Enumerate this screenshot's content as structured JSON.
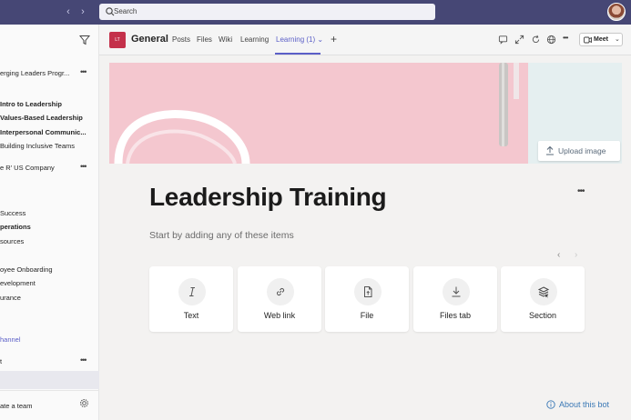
{
  "topbar": {
    "back_arrow": "‹",
    "forward_arrow": "›",
    "search_placeholder": "Search",
    "colors": {
      "background": "#464775"
    }
  },
  "sidebar": {
    "items": [
      {
        "label": "erging Leaders Progr...",
        "style": "normal"
      },
      {
        "label": "Intro to Leadership",
        "style": "bold"
      },
      {
        "label": "Values-Based Leadership",
        "style": "bold"
      },
      {
        "label": "Interpersonal Communic...",
        "style": "bold"
      },
      {
        "label": "Building Inclusive Teams",
        "style": "normal"
      },
      {
        "label": "e R' US Company",
        "style": "normal"
      },
      {
        "label": "Success",
        "style": "normal"
      },
      {
        "label": "perations",
        "style": "bold"
      },
      {
        "label": "sources",
        "style": "normal"
      },
      {
        "label": "oyee Onboarding",
        "style": "normal"
      },
      {
        "label": "evelopment",
        "style": "normal"
      },
      {
        "label": "urance",
        "style": "normal"
      },
      {
        "label": "hannel",
        "style": "link"
      },
      {
        "label": "t",
        "style": "normal"
      }
    ],
    "more_label": "•••",
    "footer_label": "ate a team"
  },
  "header": {
    "team_logo_text": "LT",
    "channel_title": "General",
    "tabs": [
      {
        "label": "Posts"
      },
      {
        "label": "Files"
      },
      {
        "label": "Wiki"
      },
      {
        "label": "Learning"
      },
      {
        "label": "Learning (1) ⌄",
        "active": true
      }
    ],
    "add_tab": "+",
    "more_label": "•••",
    "meet_label": "Meet",
    "meet_chevron": "⌄",
    "accent": "#5b5fc7"
  },
  "main": {
    "upload_label": "Upload image",
    "page_title": "Leadership Training",
    "more_label": "•••",
    "subtitle": "Start by adding any of these items",
    "carousel_prev": "‹",
    "carousel_next": "›",
    "cards": [
      {
        "label": "Text",
        "icon": "text-italic-icon"
      },
      {
        "label": "Web link",
        "icon": "link-icon"
      },
      {
        "label": "File",
        "icon": "file-icon"
      },
      {
        "label": "Files tab",
        "icon": "download-icon"
      },
      {
        "label": "Section",
        "icon": "layers-icon"
      }
    ],
    "about_bot_label": "About this bot"
  }
}
